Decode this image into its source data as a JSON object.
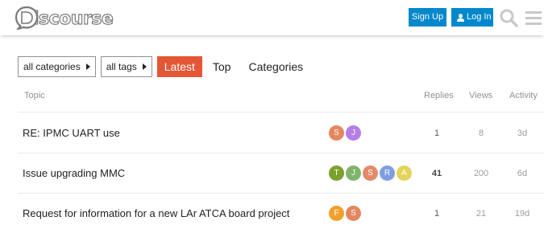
{
  "header": {
    "logo_text": "iscourse",
    "signup_label": "Sign Up",
    "login_label": "Log In",
    "icons": [
      "discourse-logo-icon",
      "user-icon",
      "search-icon",
      "hamburger-menu-icon"
    ],
    "accent_color": "#0088cc"
  },
  "nav": {
    "categories_dropdown": "all categories",
    "tags_dropdown": "all tags",
    "latest_label": "Latest",
    "top_label": "Top",
    "categories_label": "Categories",
    "active_color": "#e45735"
  },
  "table": {
    "headers": {
      "topic": "Topic",
      "replies": "Replies",
      "views": "Views",
      "activity": "Activity"
    },
    "rows": [
      {
        "title": "RE: IPMC UART use",
        "posters": [
          {
            "letter": "S",
            "color": "#e4875f"
          },
          {
            "letter": "J",
            "color": "#b67ee6"
          }
        ],
        "replies": "1",
        "views": "8",
        "activity": "3d"
      },
      {
        "title": "Issue upgrading MMC",
        "posters": [
          {
            "letter": "T",
            "color": "#7ba12d"
          },
          {
            "letter": "J",
            "color": "#80b46c"
          },
          {
            "letter": "S",
            "color": "#e38a6b"
          },
          {
            "letter": "R",
            "color": "#7f9ee2"
          },
          {
            "letter": "A",
            "color": "#e5d45a"
          }
        ],
        "replies": "41",
        "views": "200",
        "activity": "6d"
      },
      {
        "title": "Request for information for a new LAr ATCA board project",
        "posters": [
          {
            "letter": "F",
            "color": "#f0a12b"
          },
          {
            "letter": "S",
            "color": "#e4875f"
          }
        ],
        "replies": "1",
        "views": "21",
        "activity": "19d"
      }
    ]
  }
}
